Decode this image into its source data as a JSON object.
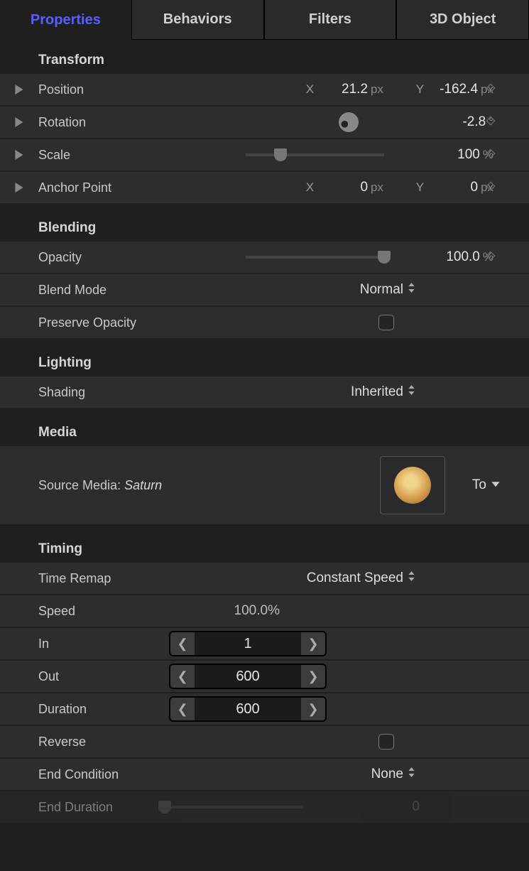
{
  "tabs": {
    "properties": "Properties",
    "behaviors": "Behaviors",
    "filters": "Filters",
    "object3d": "3D Object"
  },
  "transform": {
    "title": "Transform",
    "position": {
      "label": "Position",
      "xLabel": "X",
      "xVal": "21.2",
      "xUnit": "px",
      "yLabel": "Y",
      "yVal": "-162.4",
      "yUnit": "px"
    },
    "rotation": {
      "label": "Rotation",
      "val": "-2.8",
      "unit": "°"
    },
    "scale": {
      "label": "Scale",
      "val": "100",
      "unit": "%"
    },
    "anchor": {
      "label": "Anchor Point",
      "xLabel": "X",
      "xVal": "0",
      "xUnit": "px",
      "yLabel": "Y",
      "yVal": "0",
      "yUnit": "px"
    }
  },
  "blending": {
    "title": "Blending",
    "opacity": {
      "label": "Opacity",
      "val": "100.0",
      "unit": "%"
    },
    "blendMode": {
      "label": "Blend Mode",
      "val": "Normal"
    },
    "preserve": {
      "label": "Preserve Opacity"
    }
  },
  "lighting": {
    "title": "Lighting",
    "shading": {
      "label": "Shading",
      "val": "Inherited"
    }
  },
  "media": {
    "title": "Media",
    "sourcePrefix": "Source Media: ",
    "sourceName": "Saturn",
    "toLabel": "To"
  },
  "timing": {
    "title": "Timing",
    "timeRemap": {
      "label": "Time Remap",
      "val": "Constant Speed"
    },
    "speed": {
      "label": "Speed",
      "val": "100.0%"
    },
    "in": {
      "label": "In",
      "val": "1"
    },
    "out": {
      "label": "Out",
      "val": "600"
    },
    "duration": {
      "label": "Duration",
      "val": "600"
    },
    "reverse": {
      "label": "Reverse"
    },
    "endCondition": {
      "label": "End Condition",
      "val": "None"
    },
    "endDuration": {
      "label": "End Duration",
      "val": "0"
    }
  }
}
